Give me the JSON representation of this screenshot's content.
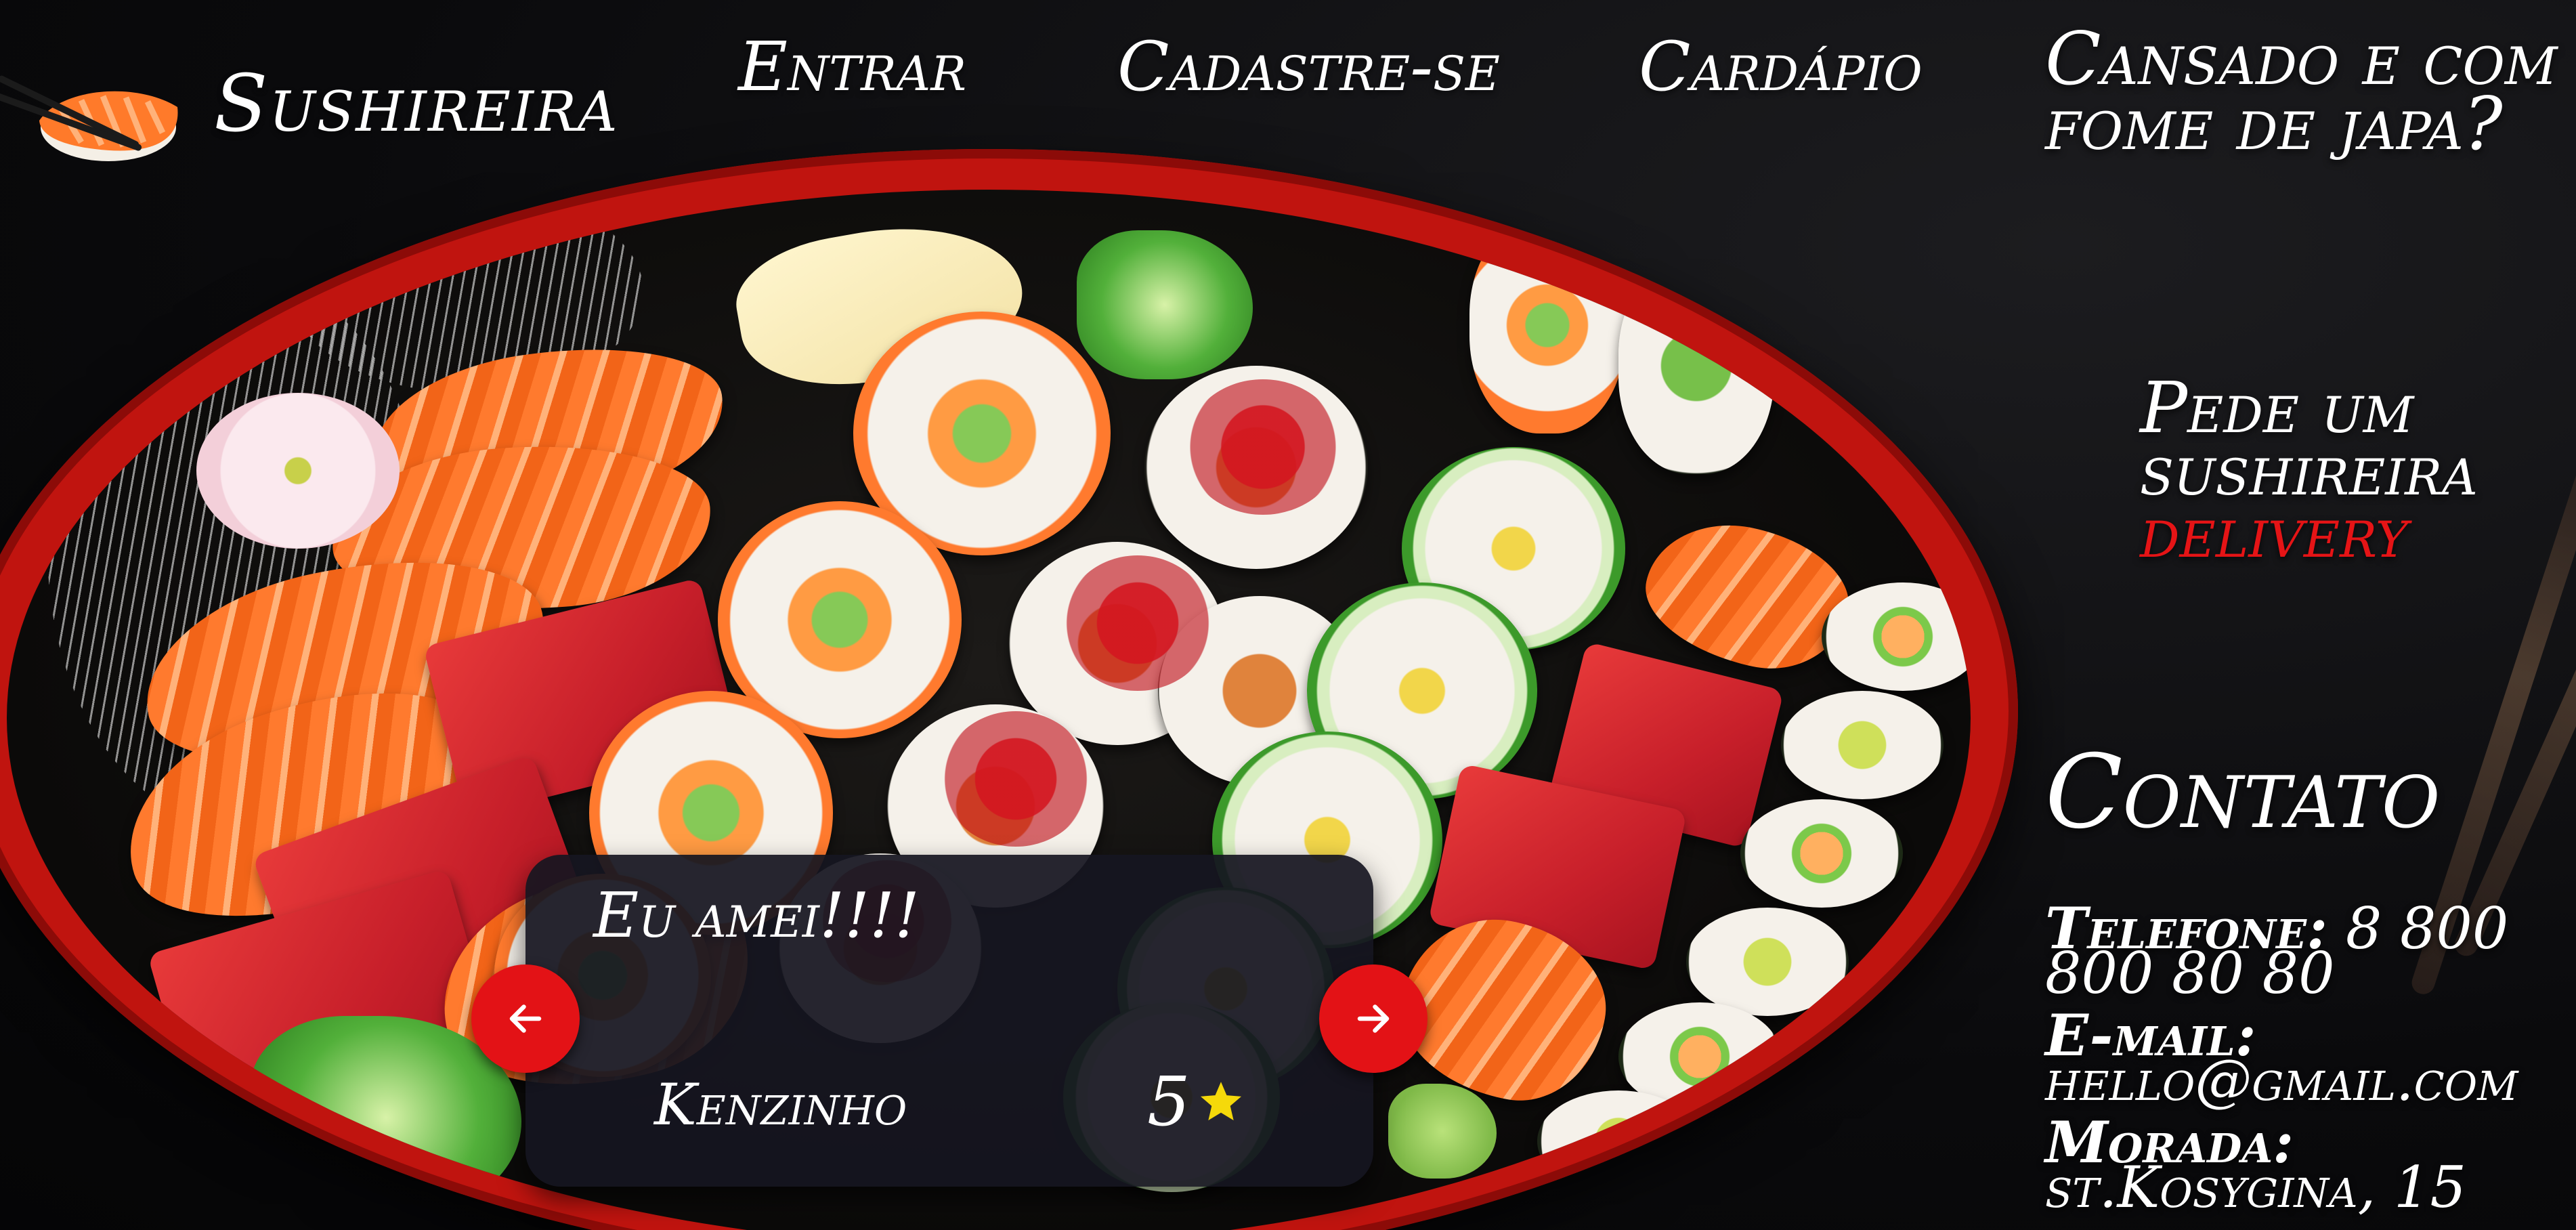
{
  "brand": {
    "name": "Sushireira",
    "logo_icon": "sushi-nigiri-chopsticks-icon"
  },
  "nav": {
    "items": [
      {
        "label": "Entrar"
      },
      {
        "label": "Cadastre-se"
      },
      {
        "label": "Cardápio"
      }
    ]
  },
  "hero": {
    "tagline": "Cansado e com fome de japa?",
    "promo_line1": "Pede um",
    "promo_line2": "sushireira",
    "promo_highlight": "delivery"
  },
  "contact": {
    "title": "Contato",
    "phone_label": "Telefone:",
    "phone_value": "8 800 800 80 80",
    "email_label": "E-mail:",
    "email_value": "hello@gmail.com",
    "address_label": "Morada:",
    "address_value": "st.Kosygina, 15"
  },
  "testimonial": {
    "text": "Eu amei!!!!",
    "author": "Kenzinho",
    "rating": "5",
    "rating_value": 5,
    "prev_icon": "arrow-left-icon",
    "next_icon": "arrow-right-icon"
  },
  "colors": {
    "accent_red": "#e31216",
    "highlight_red": "#e51416",
    "star_yellow": "#f5d90a",
    "card_bg": "#161620",
    "platter_red": "#c0140f",
    "text": "#ffffff"
  }
}
